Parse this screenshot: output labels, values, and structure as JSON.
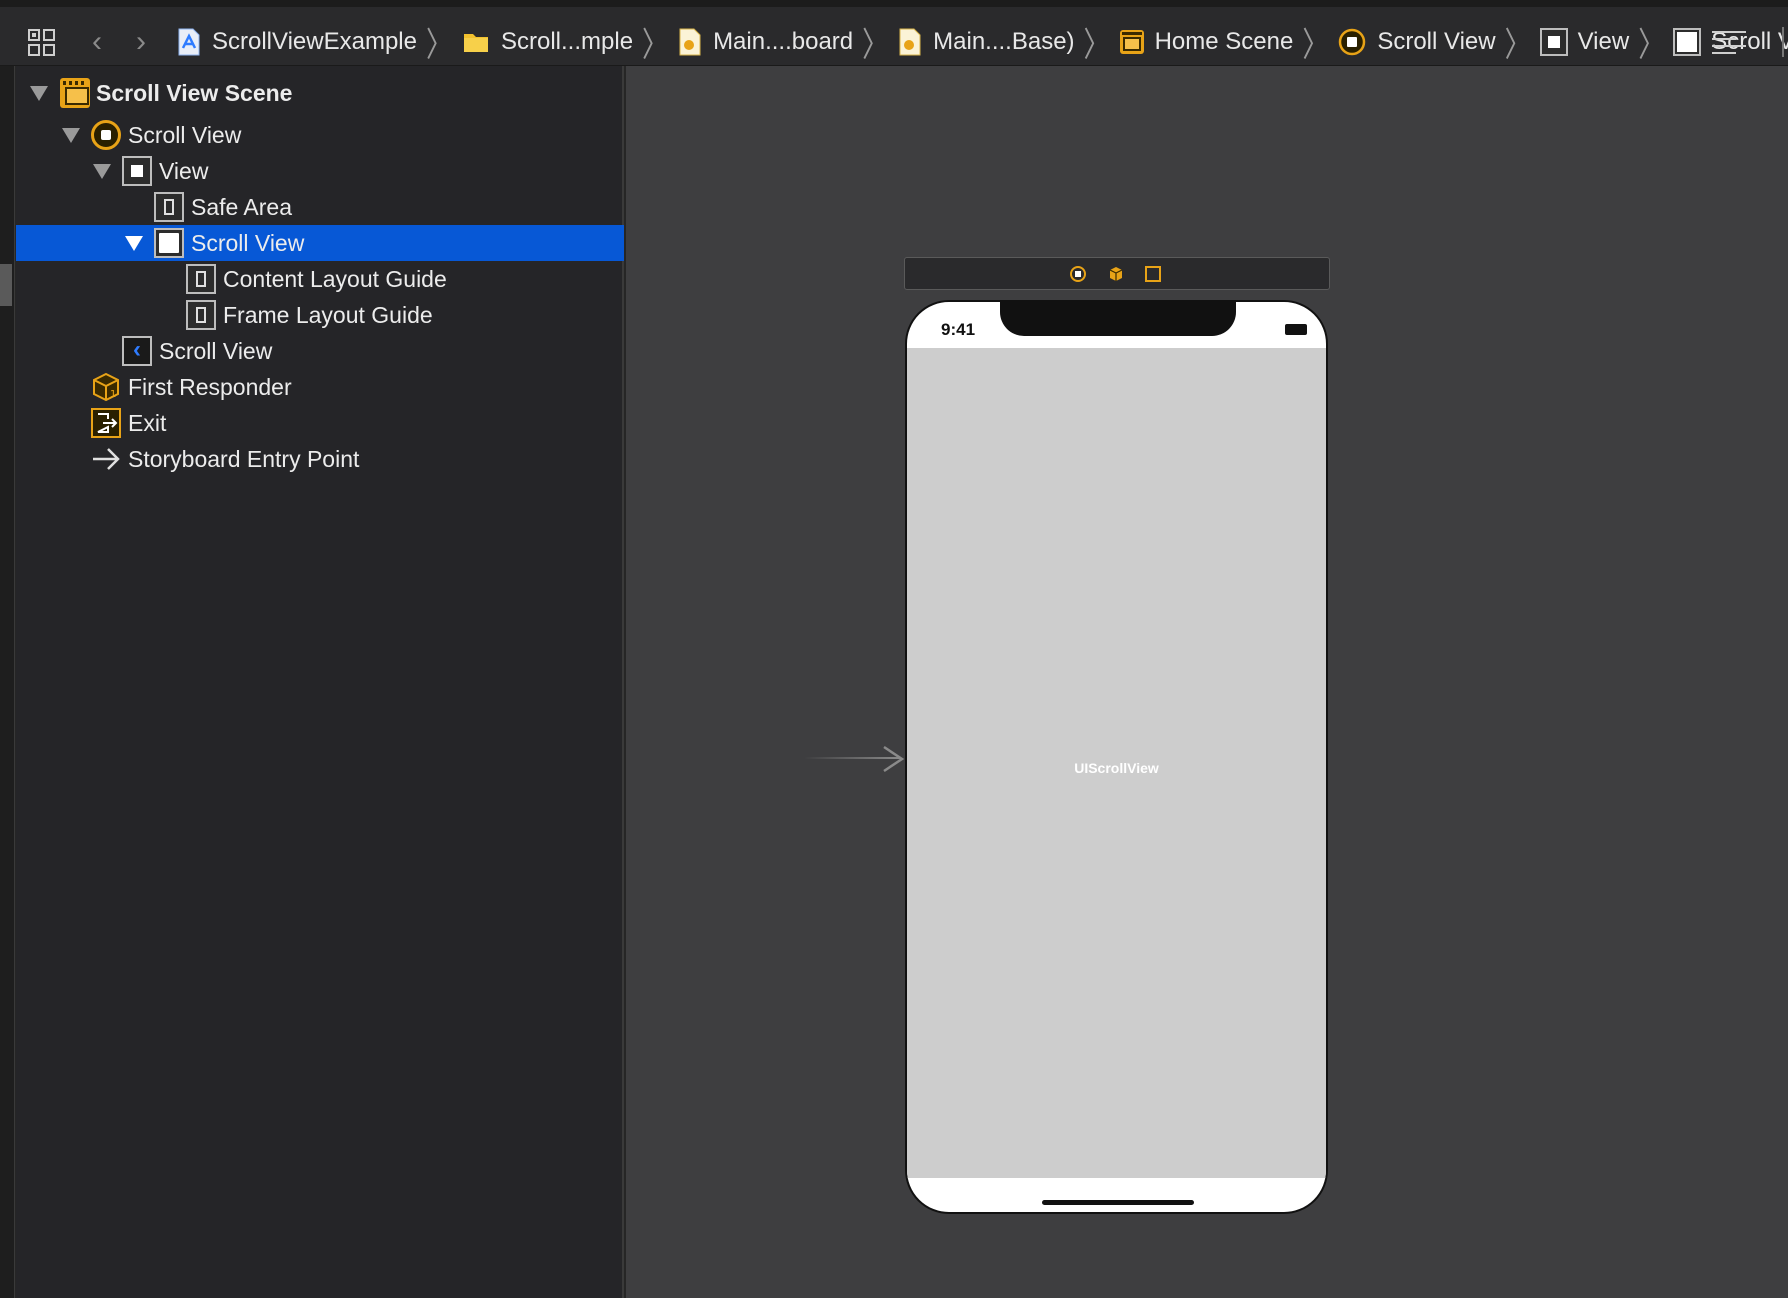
{
  "jumpbar": {
    "crumbs": [
      {
        "label": "ScrollViewExample",
        "icon": "project-icon"
      },
      {
        "label": "Scroll...mple",
        "icon": "folder-icon"
      },
      {
        "label": "Main....board",
        "icon": "storyboard-file-icon"
      },
      {
        "label": "Main....Base)",
        "icon": "storyboard-file-icon"
      },
      {
        "label": "Home Scene",
        "icon": "scene-icon"
      },
      {
        "label": "Scroll View",
        "icon": "view-controller-icon"
      },
      {
        "label": "View",
        "icon": "view-icon"
      },
      {
        "label": "Scroll View",
        "icon": "scroll-view-icon"
      }
    ],
    "back": "‹",
    "forward": "›"
  },
  "outline": {
    "items": [
      {
        "label": "Scroll View Scene",
        "icon": "scene-icon"
      },
      {
        "label": "Scroll View",
        "icon": "view-controller-icon"
      },
      {
        "label": "View",
        "icon": "view-icon"
      },
      {
        "label": "Safe Area",
        "icon": "layout-guide-icon"
      },
      {
        "label": "Scroll View",
        "icon": "scroll-view-icon",
        "selected": true
      },
      {
        "label": "Content Layout Guide",
        "icon": "layout-guide-icon"
      },
      {
        "label": "Frame Layout Guide",
        "icon": "layout-guide-icon"
      },
      {
        "label": "Scroll View",
        "icon": "navigation-item-icon"
      },
      {
        "label": "First Responder",
        "icon": "first-responder-cube-icon"
      },
      {
        "label": "Exit",
        "icon": "exit-icon"
      },
      {
        "label": "Storyboard Entry Point",
        "icon": "entry-arrow-icon"
      }
    ]
  },
  "device": {
    "time": "9:41",
    "placeholder": "UIScrollView"
  },
  "colors": {
    "selection": "#0758d6",
    "accent": "#e8a317",
    "canvas": "#3e3e40",
    "sidebar": "#252528"
  }
}
